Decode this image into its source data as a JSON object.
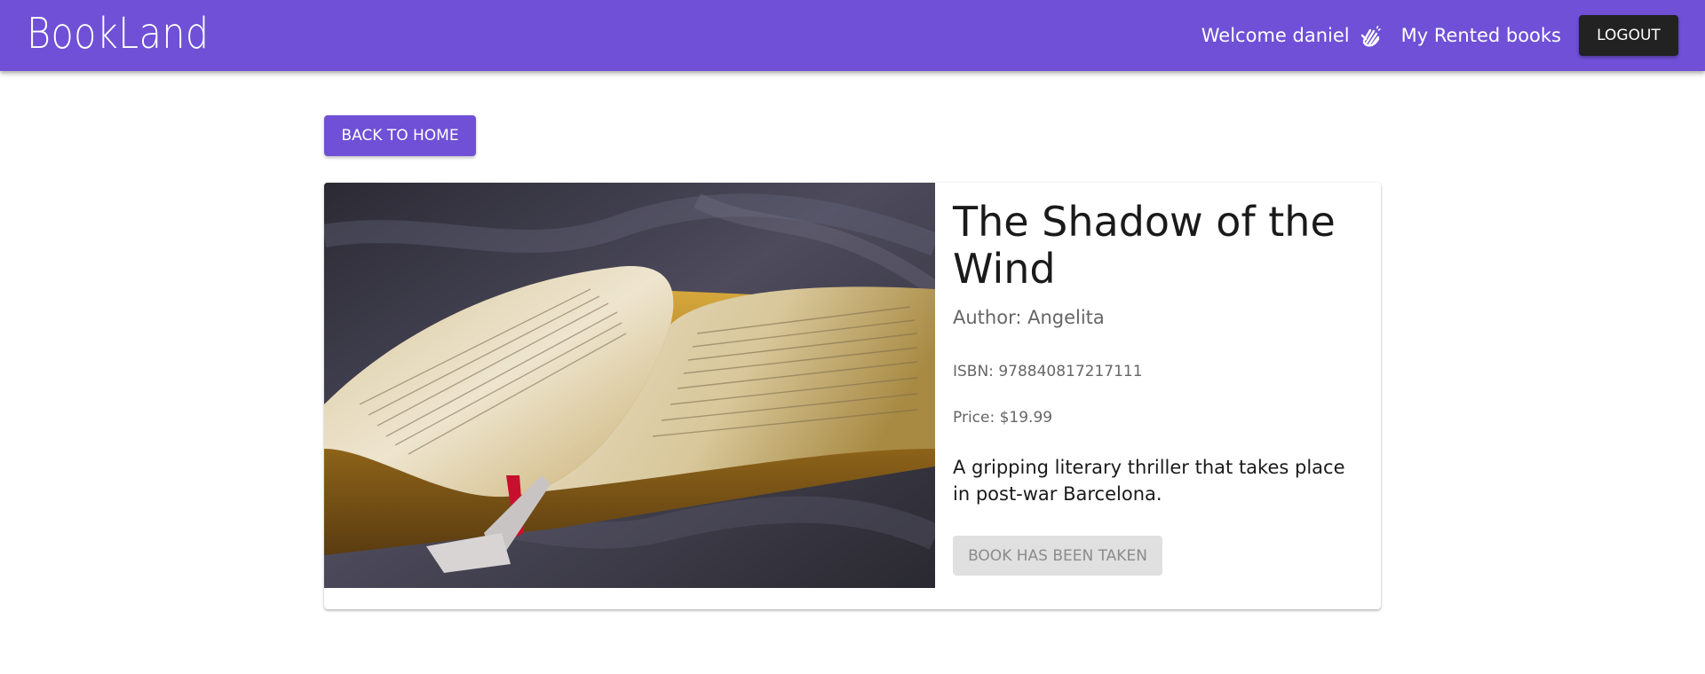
{
  "header": {
    "brand": "BookLand",
    "welcome_text": "Welcome daniel",
    "wave_icon": "waving-hand-icon",
    "rented_link": "My Rented books",
    "logout_label": "LOGOUT",
    "brand_color": "#6f50d6"
  },
  "main": {
    "back_label": "BACK TO HOME",
    "book": {
      "cover_image": "open-book-photo",
      "title": "The Shadow of the Wind",
      "author": "Author: Angelita",
      "isbn": "ISBN: 978840817217111",
      "price": "Price: $19.99",
      "description": "A gripping literary thriller that takes place in post-war Barcelona.",
      "status_label": "BOOK HAS BEEN TAKEN"
    }
  }
}
